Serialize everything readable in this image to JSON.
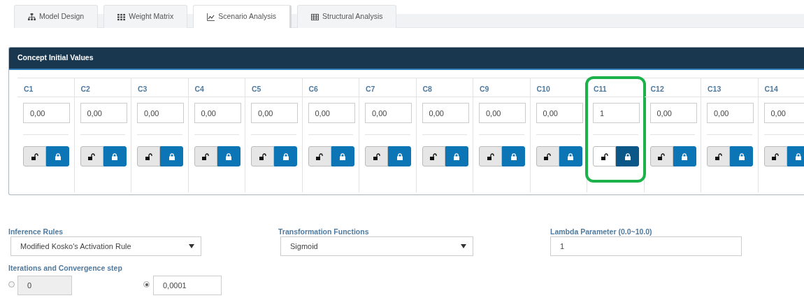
{
  "tabs": [
    {
      "label": "Model Design",
      "selected": false
    },
    {
      "label": "Weight Matrix",
      "selected": false
    },
    {
      "label": "Scenario Analysis",
      "selected": true
    },
    {
      "label": "Structural Analysis",
      "selected": false
    }
  ],
  "panel": {
    "title": "Concept Initial Values",
    "concepts": [
      {
        "name": "C1",
        "value": "0,00",
        "locked": true,
        "highlighted": false
      },
      {
        "name": "C2",
        "value": "0,00",
        "locked": true,
        "highlighted": false
      },
      {
        "name": "C3",
        "value": "0,00",
        "locked": true,
        "highlighted": false
      },
      {
        "name": "C4",
        "value": "0,00",
        "locked": true,
        "highlighted": false
      },
      {
        "name": "C5",
        "value": "0,00",
        "locked": true,
        "highlighted": false
      },
      {
        "name": "C6",
        "value": "0,00",
        "locked": true,
        "highlighted": false
      },
      {
        "name": "C7",
        "value": "0,00",
        "locked": true,
        "highlighted": false
      },
      {
        "name": "C8",
        "value": "0,00",
        "locked": true,
        "highlighted": false
      },
      {
        "name": "C9",
        "value": "0,00",
        "locked": true,
        "highlighted": false
      },
      {
        "name": "C10",
        "value": "0,00",
        "locked": true,
        "highlighted": false
      },
      {
        "name": "C11",
        "value": "1",
        "locked": true,
        "highlighted": true
      },
      {
        "name": "C12",
        "value": "0,00",
        "locked": true,
        "highlighted": false
      },
      {
        "name": "C13",
        "value": "0,00",
        "locked": true,
        "highlighted": false
      },
      {
        "name": "C14",
        "value": "0,00",
        "locked": true,
        "highlighted": false
      }
    ]
  },
  "settings": {
    "inference_rules": {
      "label": "Inference Rules",
      "value": "Modified Kosko's Activation Rule"
    },
    "transformation_functions": {
      "label": "Transformation Functions",
      "value": "Sigmoid"
    },
    "lambda_parameter": {
      "label": "Lambda Parameter (0.0~10.0)",
      "value": "1"
    },
    "iterations": {
      "label": "Iterations and Convergence step",
      "options": [
        {
          "value": "0",
          "selected": false
        },
        {
          "value": "0,0001",
          "selected": true
        }
      ]
    }
  }
}
